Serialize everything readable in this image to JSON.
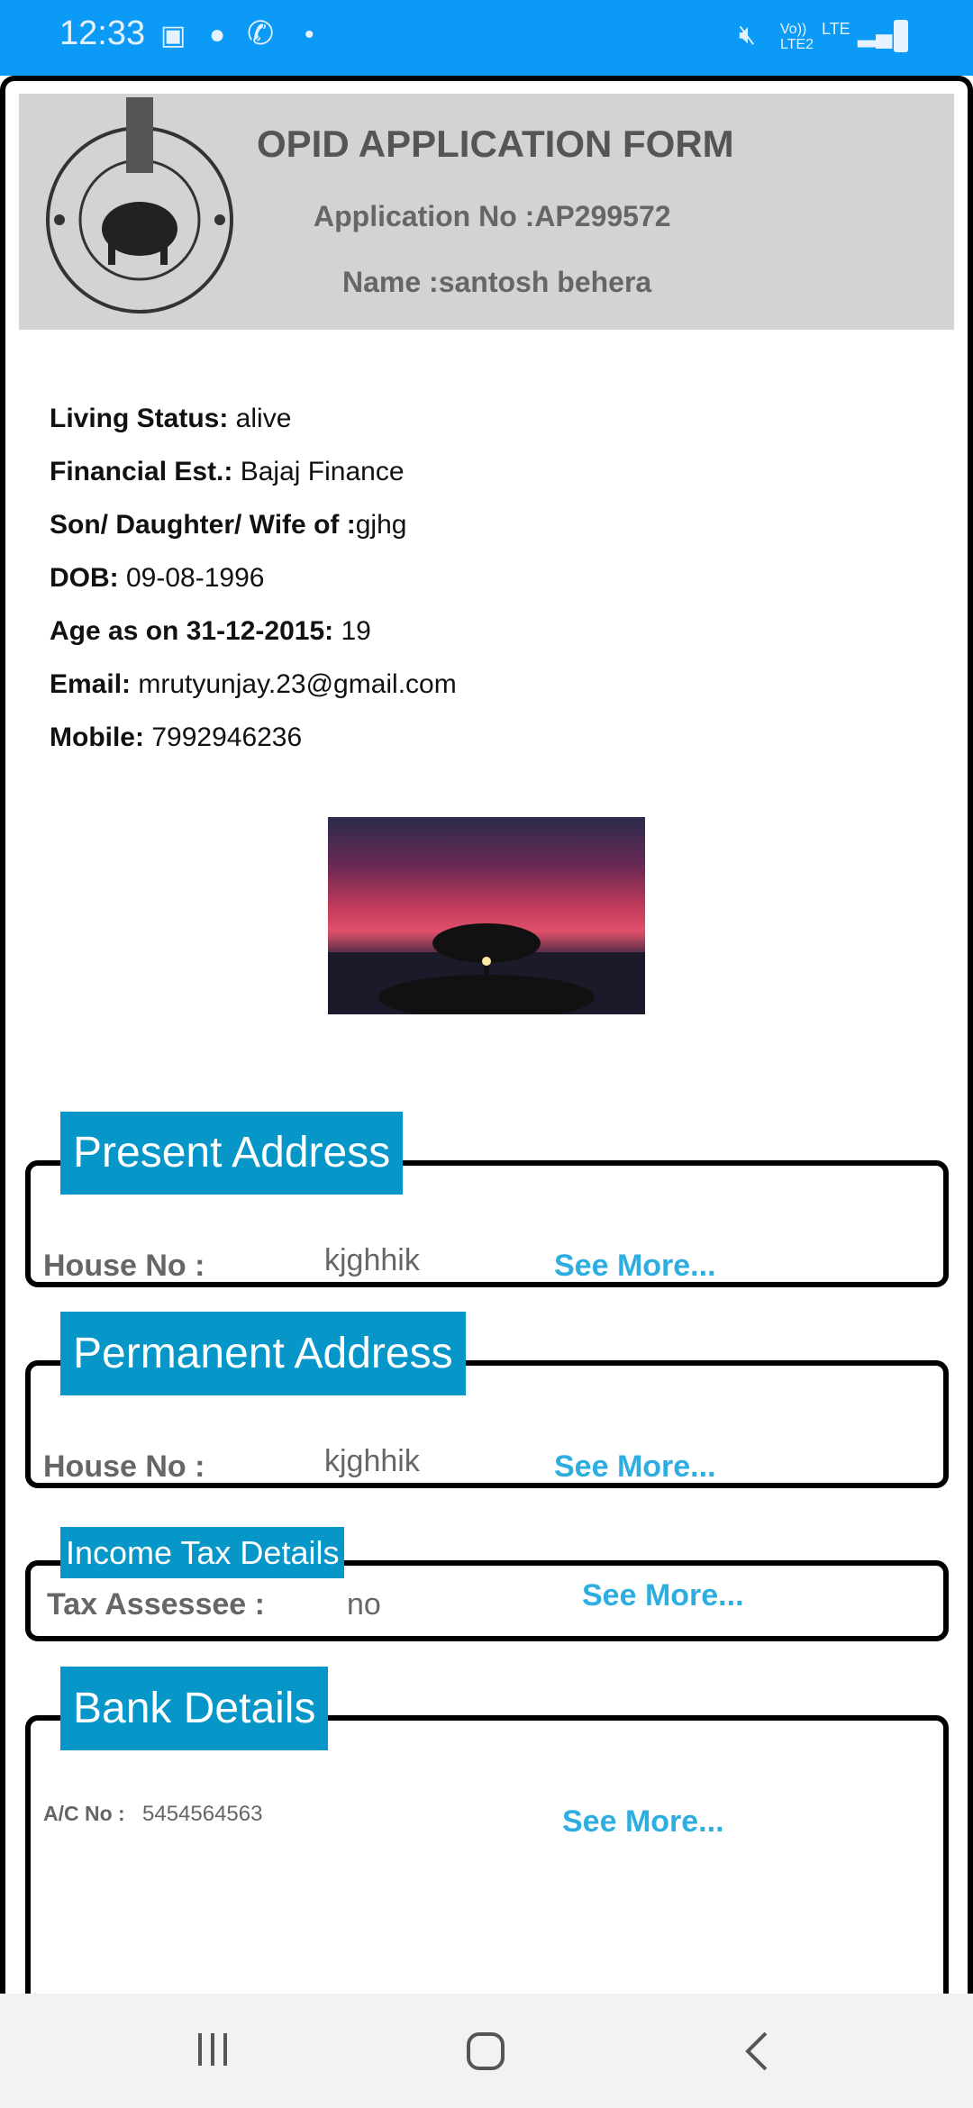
{
  "status_bar": {
    "time": "12:33",
    "icons": [
      "gallery-icon",
      "shopping-bag-icon",
      "phone-call-icon",
      "dot-icon",
      "mute-icon",
      "volte-icon",
      "lte-icon",
      "signal-icon",
      "battery-charging-icon"
    ],
    "volte": "Vo)) LTE2",
    "lte": "LTE"
  },
  "header": {
    "title": "OPID APPLICATION FORM",
    "application_no": "Application No :AP299572",
    "name": "Name :santosh behera",
    "logo": "odisha-government-emblem",
    "bg_color": "#d3d3d3"
  },
  "fields": [
    {
      "label": "Living Status:",
      "value": " alive"
    },
    {
      "label": "Financial Est.:",
      "value": " Bajaj Finance"
    },
    {
      "label": "Son/ Daughter/ Wife of :",
      "value": "gjhg"
    },
    {
      "label": "DOB:",
      "value": " 09-08-1996"
    },
    {
      "label": "Age as on 31-12-2015:",
      "value": " 19"
    },
    {
      "label": "Email:",
      "value": " mrutyunjay.23@gmail.com"
    },
    {
      "label": "Mobile:",
      "value": " 7992946236"
    }
  ],
  "photo": "sunset-tree-photo",
  "sections": {
    "present": {
      "title": "Present Address",
      "label": "House No :",
      "value": "kjghhik",
      "more": "See More..."
    },
    "permanent": {
      "title": "Permanent Address",
      "label": "House No :",
      "value": "kjghhik",
      "more": "See More..."
    },
    "income_tax": {
      "title": "Income Tax Details",
      "label": "Tax Assessee :",
      "value": "no",
      "more": "See More..."
    },
    "bank": {
      "title": "Bank Details",
      "label": "A/C No :",
      "value": "5454564563",
      "more": "See More..."
    }
  },
  "colors": {
    "status_bar": "#0b9bf6",
    "section_tag": "#0796c8",
    "see_more": "#2eaee0"
  },
  "nav_bar": [
    "recent-apps-icon",
    "home-icon",
    "back-icon"
  ]
}
